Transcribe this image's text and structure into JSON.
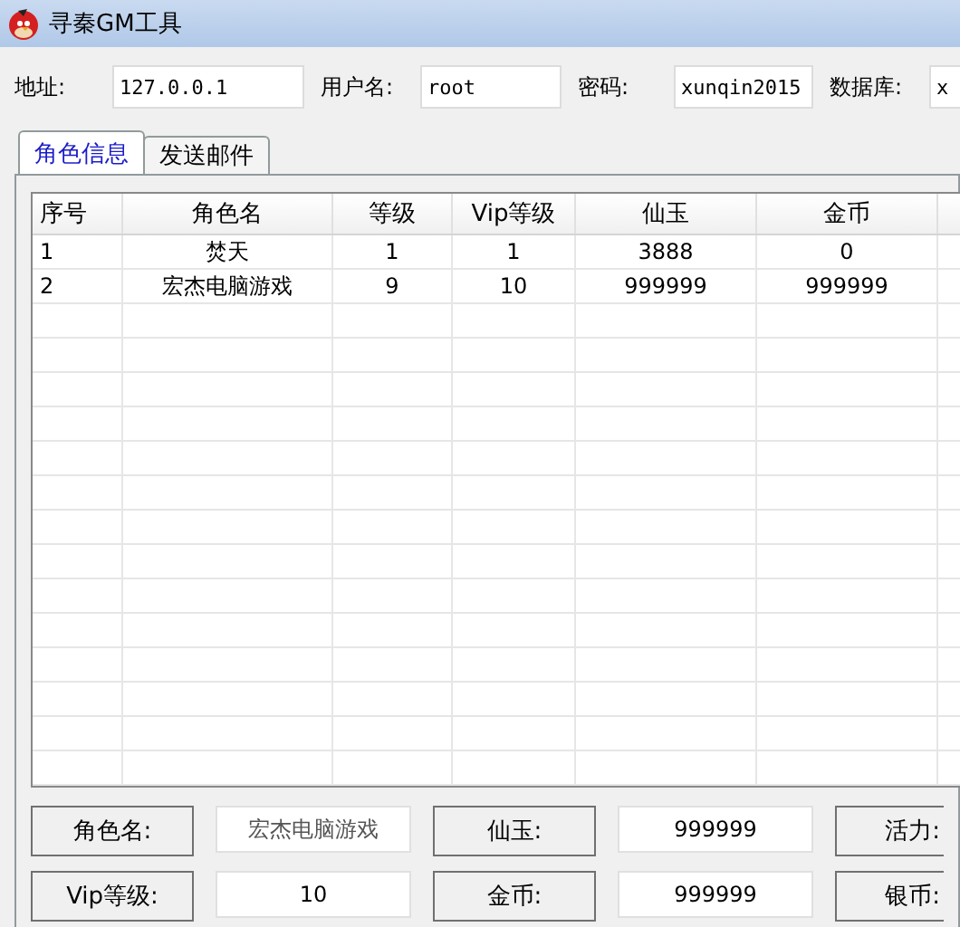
{
  "window": {
    "title": "寻秦GM工具"
  },
  "connection": [
    {
      "label": "地址:",
      "value": "127.0.0.1"
    },
    {
      "label": "用户名:",
      "value": "root"
    },
    {
      "label": "密码:",
      "value": "xunqin2015"
    },
    {
      "label": "数据库:",
      "value": "x"
    }
  ],
  "tabs": [
    {
      "label": "角色信息",
      "selected": true
    },
    {
      "label": "发送邮件",
      "selected": false
    }
  ],
  "table": {
    "columns": [
      "序号",
      "角色名",
      "等级",
      "Vip等级",
      "仙玉",
      "金币"
    ],
    "rows": [
      [
        "1",
        "焚天",
        "1",
        "1",
        "3888",
        "0"
      ],
      [
        "2",
        "宏杰电脑游戏",
        "9",
        "10",
        "999999",
        "999999"
      ]
    ]
  },
  "form": [
    [
      {
        "label": "角色名:",
        "value": "宏杰电脑游戏",
        "disabled": true
      },
      {
        "label": "仙玉:",
        "value": "999999",
        "disabled": false
      },
      {
        "label": "活力:"
      }
    ],
    [
      {
        "label": "Vip等级:",
        "value": "10",
        "disabled": false
      },
      {
        "label": "金币:",
        "value": "999999",
        "disabled": false
      },
      {
        "label": "银币:"
      }
    ]
  ]
}
